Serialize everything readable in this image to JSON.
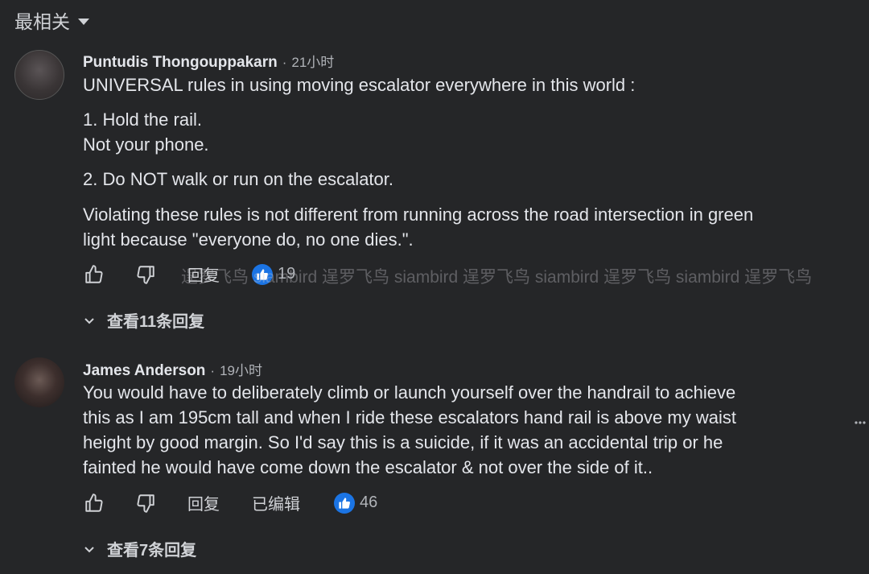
{
  "sort": {
    "label": "最相关"
  },
  "comments": [
    {
      "author": "Puntudis Thongouppakarn",
      "separator": "·",
      "time": "21小时",
      "lines": [
        "UNIVERSAL rules in using moving escalator everywhere in this world :",
        "1. Hold the rail.",
        "Not your phone.",
        "2. Do NOT walk or run on the escalator.",
        "Violating these rules is not different from running across the road intersection in green",
        "light because \"everyone do, no one dies.\"."
      ],
      "reply_label": "回复",
      "likes": "19",
      "view_replies": "查看11条回复"
    },
    {
      "author": "James Anderson",
      "separator": "·",
      "time": "19小时",
      "lines": [
        "You would have to deliberately climb or launch yourself over the handrail to achieve",
        "this as I am 195cm tall and when I ride these escalators hand rail is above my waist",
        "height by good margin. So I'd say this is a suicide, if it was an accidental trip or he",
        "fainted he would have come down the escalator & not over the side of it.."
      ],
      "reply_label": "回复",
      "edited_label": "已编辑",
      "likes": "46",
      "view_replies": "查看7条回复"
    }
  ],
  "watermark": "逞罗飞鸟 siambird 逞罗飞鸟 siambird 逞罗飞鸟 siambird 逞罗飞鸟 siambird 逞罗飞鸟",
  "icons": {
    "like": "thumbs-up-outline-icon",
    "dislike": "thumbs-down-outline-icon",
    "like_badge": "like-badge-icon",
    "expand": "chevron-down-icon",
    "more": "more-options-icon"
  },
  "colors": {
    "background": "#252628",
    "text": "#e4e6eb",
    "muted": "#b0b3b8",
    "like_blue": "#1b74e4"
  }
}
